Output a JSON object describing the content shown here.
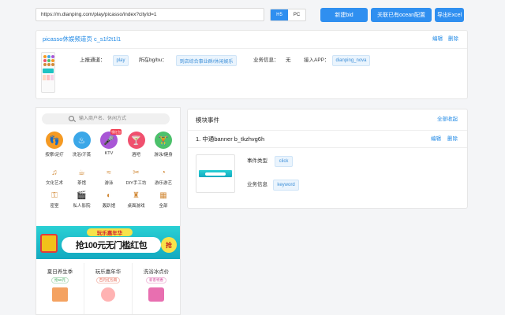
{
  "toolbar": {
    "url_value": "https://m.dianping.com/play/picasso/index?cityId=1",
    "h5_label": "H5",
    "pc_label": "PC",
    "new_bid_label": "新建bid",
    "link_ocean_label": "关联已有ocean配置",
    "export_excel_label": "导出Excel"
  },
  "page_card": {
    "title": "picasso休娱频道页 c_s1f2t1l1",
    "edit_label": "编辑",
    "delete_label": "删除",
    "channel_label": "上报通道：",
    "channel_value": "play",
    "bg_label": "所在bg/bu：",
    "bg_value": "到店综合事业群/休闲娱乐",
    "business_label": "业务信息：",
    "business_value": "无",
    "app_label": "接入APP：",
    "app_value": "dianping_nova"
  },
  "phone": {
    "search_placeholder": "输入商户名、休闲方式",
    "categories_row1": [
      {
        "label": "按摩/足疗",
        "icon": "foot-icon",
        "color": "#f59a23",
        "glyph": "👣"
      },
      {
        "label": "洗浴/汗蒸",
        "icon": "bath-icon",
        "color": "#3ba7e8",
        "glyph": "♨"
      },
      {
        "label": "KTV",
        "icon": "microphone-icon",
        "color": "#a856d6",
        "glyph": "🎤",
        "badge": "领红包"
      },
      {
        "label": "酒吧",
        "icon": "cocktail-icon",
        "color": "#f0506e",
        "glyph": "🍸"
      },
      {
        "label": "游泳/健身",
        "icon": "dumbbell-icon",
        "color": "#4cc16b",
        "glyph": "🏋"
      }
    ],
    "categories_row2": [
      {
        "label": "文化艺术",
        "icon": "lyre-icon",
        "glyph": "♫"
      },
      {
        "label": "茶馆",
        "icon": "teapot-icon",
        "glyph": "☕"
      },
      {
        "label": "游泳",
        "icon": "swim-icon",
        "glyph": "≈"
      },
      {
        "label": "DIY手工坊",
        "icon": "scissors-icon",
        "glyph": "✂"
      },
      {
        "label": "游乐游艺",
        "icon": "pacman-icon",
        "glyph": "◔"
      }
    ],
    "categories_row3": [
      {
        "label": "密室",
        "icon": "key-icon",
        "glyph": "⚿"
      },
      {
        "label": "私人影院",
        "icon": "cinema-icon",
        "glyph": "🎬"
      },
      {
        "label": "轰趴馆",
        "icon": "mask-icon",
        "glyph": "◐"
      },
      {
        "label": "桌面游戏",
        "icon": "chess-icon",
        "glyph": "♜"
      },
      {
        "label": "全部",
        "icon": "grid-icon",
        "glyph": "▦"
      }
    ],
    "banner": {
      "top_text": "玩乐嘉年华",
      "main_text": "抢100元无门槛红包",
      "cta": "抢"
    },
    "promos": [
      {
        "title": "夏日养生季",
        "sub": "抢50元"
      },
      {
        "title": "玩乐嘉年华",
        "sub": "百元红包雨"
      },
      {
        "title": "洗浴冰点价",
        "sub": "新客特惠"
      }
    ]
  },
  "module_panel": {
    "title": "模块事件",
    "collapse_label": "全部收起",
    "item_title": "1. 中通banner b_tkzhvg6h",
    "edit_label": "编辑",
    "delete_label": "删除",
    "event_type_label": "事件类型",
    "event_type_value": "click",
    "business_label": "业务信息",
    "business_value": "keyword"
  }
}
